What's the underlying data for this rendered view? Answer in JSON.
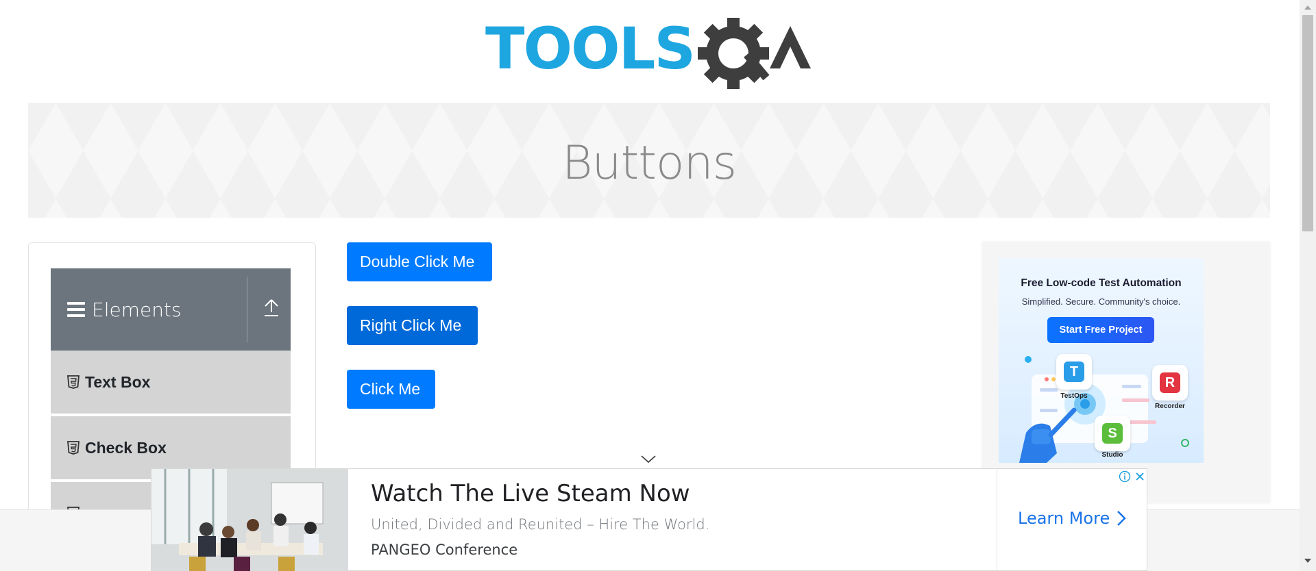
{
  "header": {
    "logo_text": "TOOLSQA",
    "logo_colors": {
      "tools": "#1ea6e0",
      "qa": "#3e3e3e"
    }
  },
  "banner": {
    "title": "Buttons"
  },
  "sidebar": {
    "group_title": "Elements",
    "items": [
      {
        "label": "Text Box",
        "icon": "html5-icon"
      },
      {
        "label": "Check Box",
        "icon": "html5-icon"
      }
    ]
  },
  "buttons": {
    "double_click": "Double Click Me",
    "right_click": "Right Click Me",
    "click": "Click Me"
  },
  "right_ad": {
    "headline": "Free Low-code Test Automation",
    "subtitle": "Simplified. Secure. Community's choice.",
    "cta": "Start Free Project",
    "products": [
      "TestOps",
      "Recorder",
      "Studio"
    ]
  },
  "bottom_ad": {
    "title": "Watch The Live Steam Now",
    "description": "United, Divided and Reunited – Hire The World.",
    "brand": "PANGEO Conference",
    "cta": "Learn More"
  },
  "colors": {
    "primary_button": "#007bff",
    "sidebar_header": "#6c757d",
    "sidebar_item": "#d4d4d4",
    "link_blue": "#1a73e8"
  }
}
